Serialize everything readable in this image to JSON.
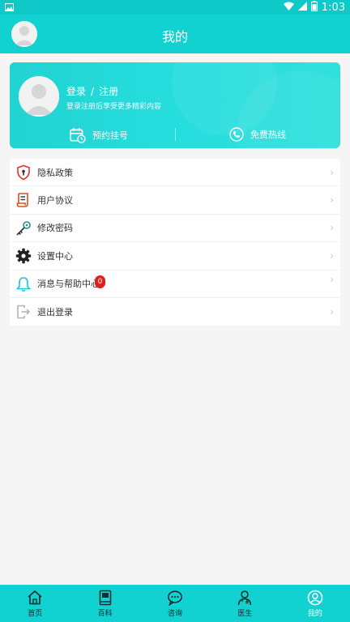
{
  "status_bar": {
    "time": "1:03"
  },
  "header": {
    "title": "我的"
  },
  "profile": {
    "login_label": "登录",
    "separator": "/",
    "register_label": "注册",
    "hint": "登录注册后享受更多精彩内容",
    "actions": [
      {
        "label": "预约挂号",
        "icon": "calendar-clock-icon"
      },
      {
        "label": "免费热线",
        "icon": "phone-icon"
      }
    ]
  },
  "menu": {
    "items": [
      {
        "label": "隐私政策",
        "icon": "shield-icon"
      },
      {
        "label": "用户协议",
        "icon": "scroll-icon"
      },
      {
        "label": "修改密码",
        "icon": "key-icon"
      },
      {
        "label": "设置中心",
        "icon": "gear-icon"
      },
      {
        "label": "消息与帮助中心",
        "icon": "bell-icon",
        "badge": "0"
      },
      {
        "label": "退出登录",
        "icon": "logout-icon"
      }
    ],
    "arrow": "›"
  },
  "tabbar": {
    "tabs": [
      {
        "label": "首页",
        "icon": "home-icon"
      },
      {
        "label": "百科",
        "icon": "book-icon"
      },
      {
        "label": "咨询",
        "icon": "chat-icon"
      },
      {
        "label": "医生",
        "icon": "doctor-icon"
      },
      {
        "label": "我的",
        "icon": "user-icon",
        "active": true
      }
    ]
  },
  "colors": {
    "primary": "#12d1d1",
    "badge": "#e02020"
  }
}
